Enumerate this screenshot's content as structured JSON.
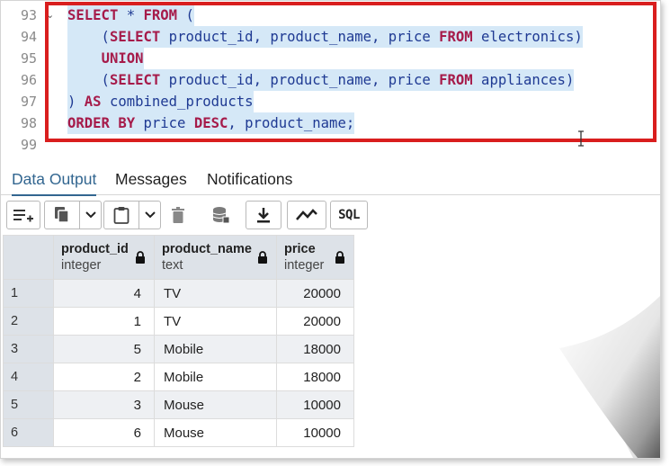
{
  "editor": {
    "lines": [
      {
        "num": "93",
        "fold": "⌄",
        "parts": [
          {
            "t": "SELECT",
            "kw": true
          },
          {
            "t": " * ",
            "kw": false
          },
          {
            "t": "FROM",
            "kw": true
          },
          {
            "t": " (",
            "kw": false
          }
        ]
      },
      {
        "num": "94",
        "fold": "",
        "parts": [
          {
            "t": "    (",
            "kw": false
          },
          {
            "t": "SELECT",
            "kw": true
          },
          {
            "t": " product_id, product_name, price ",
            "kw": false
          },
          {
            "t": "FROM",
            "kw": true
          },
          {
            "t": " electronics)",
            "kw": false
          }
        ]
      },
      {
        "num": "95",
        "fold": "",
        "parts": [
          {
            "t": "    ",
            "kw": false
          },
          {
            "t": "UNION",
            "kw": true
          }
        ]
      },
      {
        "num": "96",
        "fold": "",
        "parts": [
          {
            "t": "    (",
            "kw": false
          },
          {
            "t": "SELECT",
            "kw": true
          },
          {
            "t": " product_id, product_name, price ",
            "kw": false
          },
          {
            "t": "FROM",
            "kw": true
          },
          {
            "t": " appliances)",
            "kw": false
          }
        ]
      },
      {
        "num": "97",
        "fold": "",
        "parts": [
          {
            "t": ") ",
            "kw": false
          },
          {
            "t": "AS",
            "kw": true
          },
          {
            "t": " combined_products",
            "kw": false
          }
        ]
      },
      {
        "num": "98",
        "fold": "",
        "parts": [
          {
            "t": "ORDER BY",
            "kw": true
          },
          {
            "t": " price ",
            "kw": false
          },
          {
            "t": "DESC",
            "kw": true
          },
          {
            "t": ", product_name;",
            "kw": false
          }
        ]
      },
      {
        "num": "99",
        "fold": "",
        "parts": []
      }
    ]
  },
  "tabs": {
    "data_output": "Data Output",
    "messages": "Messages",
    "notifications": "Notifications"
  },
  "toolbar": {
    "sql_label": "SQL"
  },
  "grid": {
    "columns": [
      {
        "name": "product_id",
        "type": "integer"
      },
      {
        "name": "product_name",
        "type": "text"
      },
      {
        "name": "price",
        "type": "integer"
      }
    ],
    "rows": [
      {
        "n": "1",
        "id": "4",
        "name": "TV",
        "price": "20000"
      },
      {
        "n": "2",
        "id": "1",
        "name": "TV",
        "price": "20000"
      },
      {
        "n": "3",
        "id": "5",
        "name": "Mobile",
        "price": "18000"
      },
      {
        "n": "4",
        "id": "2",
        "name": "Mobile",
        "price": "18000"
      },
      {
        "n": "5",
        "id": "3",
        "name": "Mouse",
        "price": "10000"
      },
      {
        "n": "6",
        "id": "6",
        "name": "Mouse",
        "price": "10000"
      }
    ]
  },
  "colors": {
    "keyword": "#a61b4a",
    "identifier": "#1f3a93",
    "selection": "#d5e8f7",
    "highlight_box": "#d91e1e",
    "active_tab": "#326690"
  }
}
